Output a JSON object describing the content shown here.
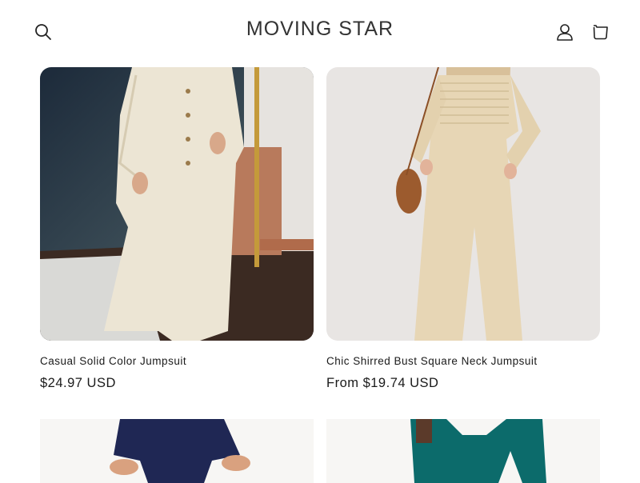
{
  "header": {
    "store_name": "MOVING STAR",
    "icons": {
      "search": "search-icon",
      "account": "user-icon",
      "cart": "cart-icon"
    }
  },
  "products": [
    {
      "title": "Casual Solid Color Jumpsuit",
      "price": "$24.97 USD"
    },
    {
      "title": "Chic Shirred Bust Square Neck Jumpsuit",
      "price": "From $19.74 USD"
    }
  ],
  "colors": {
    "text": "#121212",
    "background": "#ffffff",
    "logo": "#333333"
  }
}
